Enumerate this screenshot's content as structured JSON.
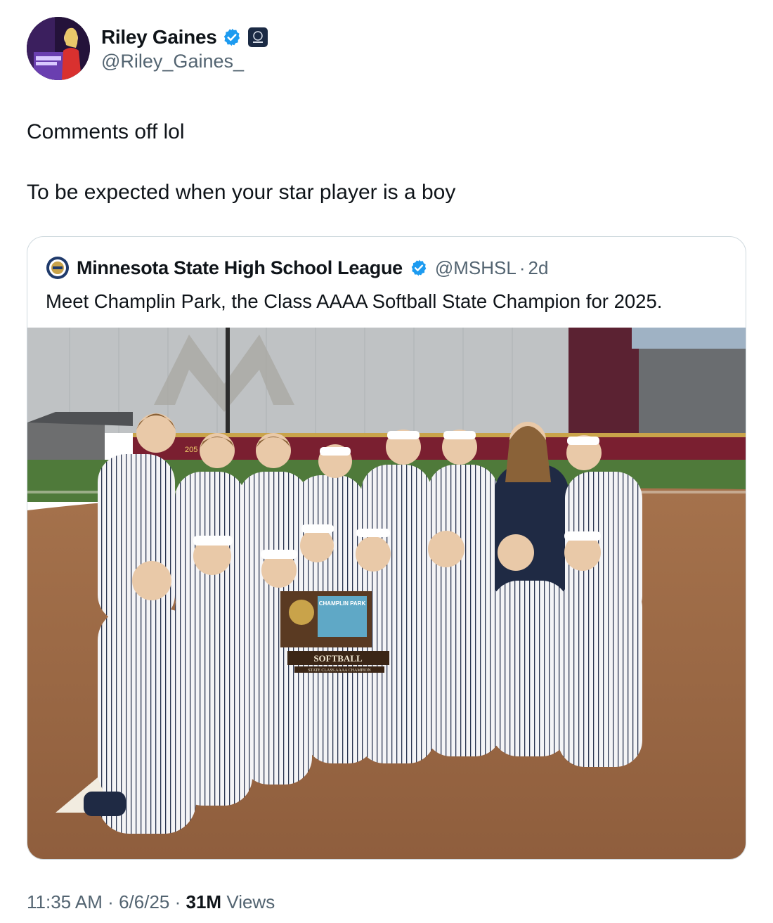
{
  "author": {
    "display_name": "Riley Gaines",
    "handle": "@Riley_Gaines_",
    "avatar_icon": "profile-photo",
    "verified_icon": "verified-badge-icon",
    "affiliate_icon": "affiliate-badge-icon"
  },
  "tweet": {
    "lines": [
      "Comments off lol",
      "To be expected when your star player is a boy"
    ]
  },
  "quote": {
    "display_name": "Minnesota State High School League",
    "handle": "@MSHSL",
    "separator": "·",
    "time": "2d",
    "text": "Meet Champlin Park, the Class AAAA Softball State Champion for 2025.",
    "photo": {
      "description_icon": "team-photo",
      "trophy_label": "SOFTBALL",
      "trophy_sublabel": "STATE CLASS AAAA CHAMPION",
      "plaque_text": "CHAMPLIN PARK",
      "fence_text": "205"
    }
  },
  "meta": {
    "time": "11:35 AM",
    "sep1": "·",
    "date": "6/6/25",
    "sep2": "·",
    "views_count": "31M",
    "views_label": "Views"
  },
  "colors": {
    "text": "#0f1419",
    "secondary": "#536471",
    "verified": "#1d9bf0",
    "border": "#cfd9de"
  }
}
